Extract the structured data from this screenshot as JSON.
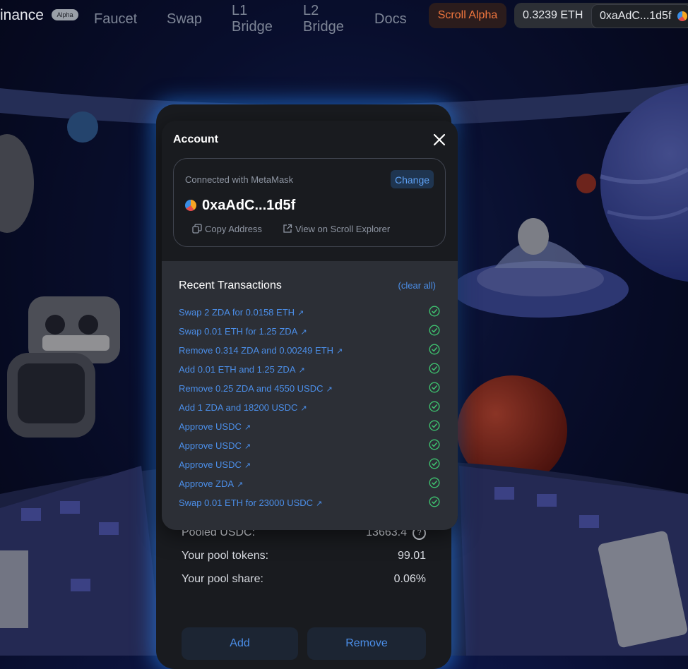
{
  "nav": {
    "brand": "inance",
    "alpha_badge": "Alpha",
    "links": [
      {
        "label": "Faucet"
      },
      {
        "label": "Swap"
      },
      {
        "label": "L1\nBridge"
      },
      {
        "label": "L2\nBridge"
      },
      {
        "label": "Docs"
      }
    ],
    "network": "Scroll Alpha",
    "balance": "0.3239 ETH",
    "address": "0xaAdC...1d5f"
  },
  "pool": {
    "rows": [
      {
        "label": "Pooled USDC:",
        "value": "13663.4",
        "help": "?"
      },
      {
        "label": "Your pool tokens:",
        "value": "99.01"
      },
      {
        "label": "Your pool share:",
        "value": "0.06%"
      }
    ],
    "add_label": "Add",
    "remove_label": "Remove"
  },
  "modal": {
    "title": "Account",
    "connected_with": "Connected with MetaMask",
    "change_label": "Change",
    "address": "0xaAdC...1d5f",
    "copy_label": "Copy Address",
    "explorer_label": "View on Scroll Explorer",
    "recent_title": "Recent Transactions",
    "clear_label": "(clear all)",
    "transactions": [
      {
        "label": "Swap 2 ZDA for 0.0158 ETH"
      },
      {
        "label": "Swap 0.01 ETH for 1.25 ZDA"
      },
      {
        "label": "Remove 0.314 ZDA and 0.00249 ETH"
      },
      {
        "label": "Add 0.01 ETH and 1.25 ZDA"
      },
      {
        "label": "Remove 0.25 ZDA and 4550 USDC"
      },
      {
        "label": "Add 1 ZDA and 18200 USDC"
      },
      {
        "label": "Approve USDC"
      },
      {
        "label": "Approve USDC"
      },
      {
        "label": "Approve USDC"
      },
      {
        "label": "Approve ZDA"
      },
      {
        "label": "Swap 0.01 ETH for 23000 USDC"
      }
    ]
  },
  "colors": {
    "accent_blue": "#4b8ee8",
    "success_green": "#3ec26f",
    "network_orange": "#f0763e",
    "card_glow": "#288cff"
  }
}
